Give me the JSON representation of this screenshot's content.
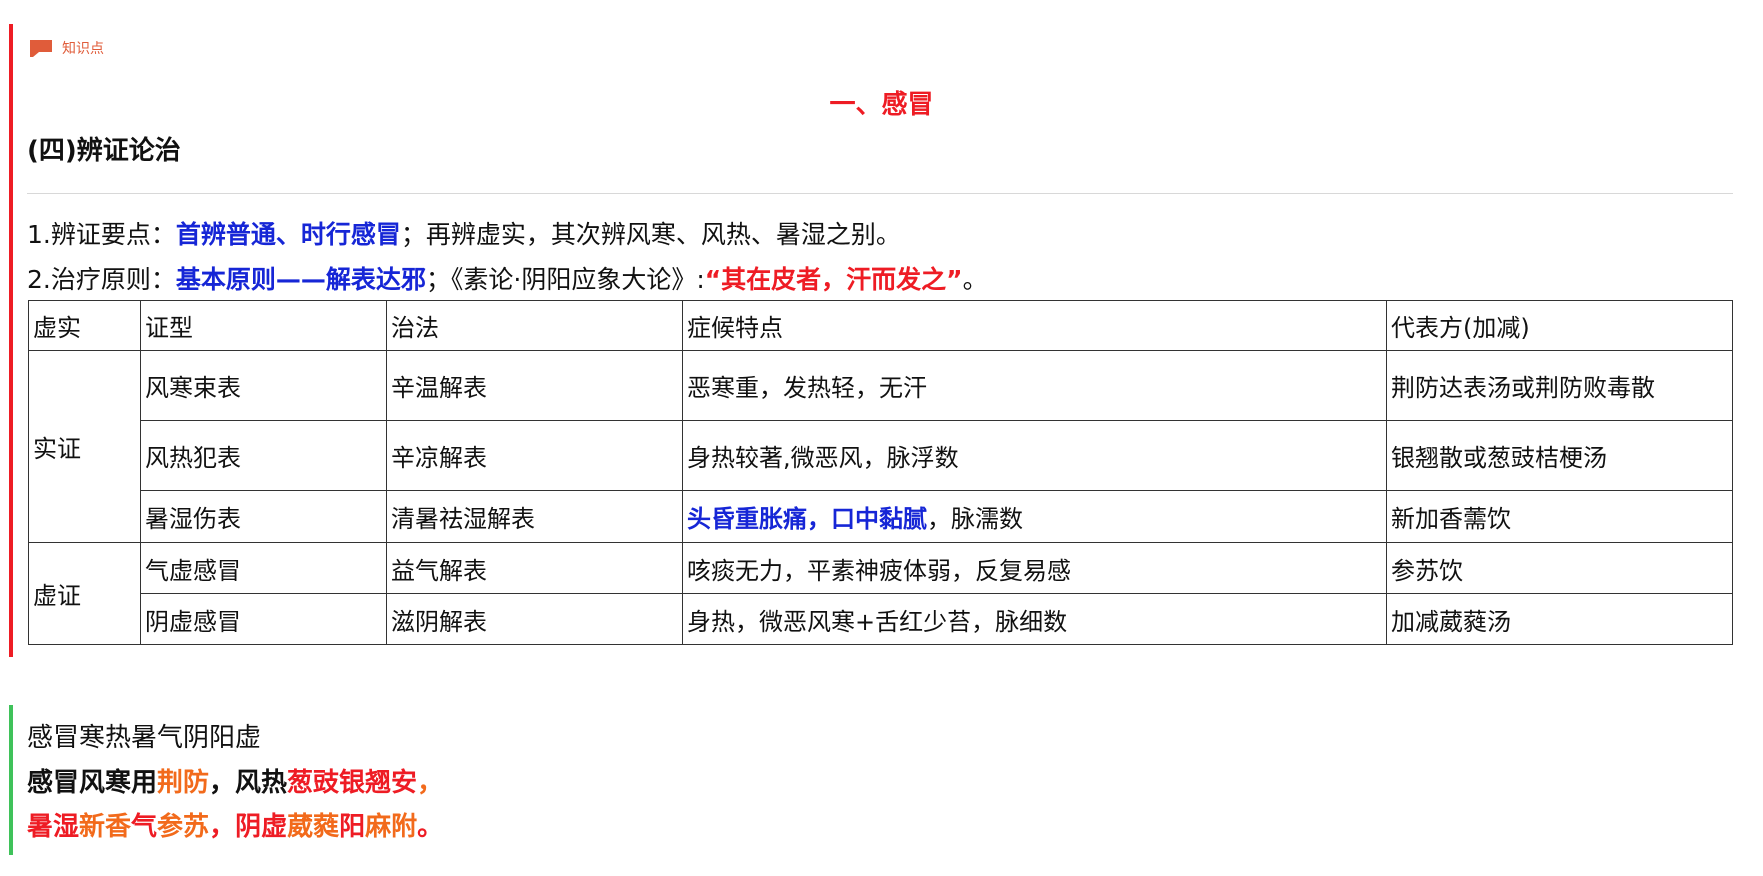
{
  "tag": {
    "icon": "flag-icon",
    "label": "知识点",
    "color": "#e05c3a"
  },
  "title": "一、感冒",
  "subtitle": "(四)辨证论治",
  "point1": {
    "prefix": "1.辨证要点：",
    "highlight": "首辨普通、时行感冒",
    "rest": "；再辨虚实，其次辨风寒、风热、暑湿之别。"
  },
  "point2": {
    "prefix": "2.治疗原则：",
    "highlight": "基本原则——解表达邪",
    "middle": "；《素论·阴阳应象大论》:",
    "quote": "“其在皮者，汗而发之”",
    "end": "。"
  },
  "table": {
    "headers": [
      "虚实",
      "证型",
      "治法",
      "症候特点",
      "代表方(加减)"
    ],
    "groups": [
      {
        "category": "实证",
        "rows": [
          {
            "type": "风寒束表",
            "method": "辛温解表",
            "symptoms_highlight": "",
            "symptoms": "恶寒重，发热轻，无汗",
            "formula": "荆防达表汤或荆防败毒散"
          },
          {
            "type": "风热犯表",
            "method": "辛凉解表",
            "symptoms_highlight": "",
            "symptoms": "身热较著,微恶风，脉浮数",
            "formula": "银翘散或葱豉桔梗汤"
          },
          {
            "type": "暑湿伤表",
            "method": "清暑祛湿解表",
            "symptoms_highlight": "头昏重胀痛，口中黏腻",
            "symptoms": "，脉濡数",
            "formula": "新加香薷饮"
          }
        ]
      },
      {
        "category": "虚证",
        "rows": [
          {
            "type": "气虚感冒",
            "method": "益气解表",
            "symptoms_highlight": "",
            "symptoms": "咳痰无力，平素神疲体弱，反复易感",
            "formula": "参苏饮"
          },
          {
            "type": "阴虚感冒",
            "method": "滋阴解表",
            "symptoms_highlight": "",
            "symptoms": "身热，微恶风寒+舌红少苔，脉细数",
            "formula": "加减葳蕤汤"
          }
        ]
      }
    ]
  },
  "mnemonic": {
    "line1": "感冒寒热暑气阴阳虚",
    "line2": [
      {
        "text": "感冒风寒用",
        "color": "black"
      },
      {
        "text": "荆防",
        "color": "orange"
      },
      {
        "text": "，风热",
        "color": "black"
      },
      {
        "text": "葱豉银翘安",
        "color": "red"
      },
      {
        "text": "，",
        "color": "orange"
      }
    ],
    "line3": [
      {
        "text": "暑湿",
        "color": "red"
      },
      {
        "text": "新香",
        "color": "orange"
      },
      {
        "text": "气",
        "color": "red"
      },
      {
        "text": "参苏",
        "color": "orange"
      },
      {
        "text": "，阴虚",
        "color": "red"
      },
      {
        "text": "葳蕤",
        "color": "orange"
      },
      {
        "text": "阳",
        "color": "red"
      },
      {
        "text": "麻附",
        "color": "orange"
      },
      {
        "text": "。",
        "color": "red"
      }
    ]
  },
  "colors": {
    "accent_red": "#ee1c24",
    "highlight_blue": "#1626d6",
    "highlight_orange": "#f26a1b",
    "bar_green": "#3fc25a"
  }
}
